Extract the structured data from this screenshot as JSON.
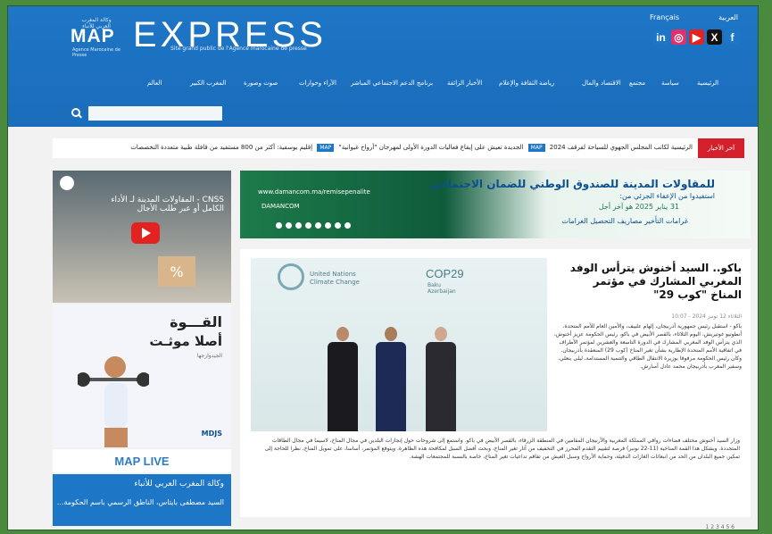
{
  "header": {
    "logo_map": "MAP",
    "logo_crown_text": "وكالة المغرب العربي للأنباء",
    "logo_under": "Agence Marocaine de Presse",
    "logo_express": "EXPRESS",
    "tagline": "Site grand public de l'Agence marocaine de presse",
    "lang_fr": "Français",
    "lang_ar": "العربية",
    "social": [
      {
        "icon": "linkedin-icon",
        "glyph": "in",
        "color": "#1e76c6"
      },
      {
        "icon": "instagram-icon",
        "glyph": "◎",
        "color": "#e1306c"
      },
      {
        "icon": "youtube-icon",
        "glyph": "▶",
        "color": "#e32222"
      },
      {
        "icon": "x-icon",
        "glyph": "X",
        "color": "#111111"
      },
      {
        "icon": "facebook-icon",
        "glyph": "f",
        "color": "#1e76c6"
      }
    ]
  },
  "nav": {
    "items": [
      "الرئيسية",
      "سياسة",
      "مجتمع",
      "الاقتصاد والمال",
      "رياضة",
      "الثقافة والإعلام",
      "الأخبار الزائفة",
      "برنامج الدعم الاجتماعي المباشر",
      "الآراء وحوارات",
      "صوت وصورة",
      "المغرب الكبير",
      "العالم"
    ]
  },
  "search": {
    "placeholder": ""
  },
  "ticker": {
    "label": "آخر الأخبار",
    "item1": "الرئيسية لكاتب المجلس الجهوي للسياحة لفرقف 2024",
    "badge": "MAP",
    "item2": "الجديدة تعيش على إيقاع فعاليات الدورة الأولى لمهرجان \"أرواح غيوانية\"",
    "item3": "إقليم يوسفية: أكثر من 800 مستفيد من قافلة طبية متعددة التخصصات"
  },
  "ad_banner": {
    "title": "للمقاولات المدينة للصندوق الوطني للضمان الاجتماعي",
    "subtitle": "استفيدوا من الإعفاء الجزئي من:",
    "date": "31 يناير 2025 هو آخر أجل",
    "pills": "غرامات التأخير  مصاريف التحصيل  الغرامات",
    "website": "www.damancom.ma/remisepenalite",
    "brand": "DAMANCOM"
  },
  "article": {
    "title": "باكو.. السيد أخنوش يترأس الوفد المغربي المشارك في مؤتمر المناخ \"كوب 29\"",
    "date": "الثلاثاء 12 نونبر 2024 - 10:07",
    "body": "باكو - استقبل رئيس جمهورية أذربيجان، إلهام علييف، والأمين العام للأمم المتحدة، أنطونيو غوتيريش، اليوم الثلاثاء، بالقصر الأبيض في باكو، رئيس الحكومة عزيز أخنوش، الذي يترأس الوفد المغربي المشارك في الدورة التاسعة والعشرين لمؤتمر الأطراف في اتفاقية الأمم المتحدة الإطارية بشأن تغير المناخ (كوب 29) المنعقدة بأذربيجان. وكان رئيس الحكومة مرفوقا بوزيرة الانتقال الطاقي والتنمية المستدامة، ليلى بنعلي، وسفير المغرب بأذربيجان محمد عادل أمبارش.",
    "body_wide": "وزار السيد أخنوش مختلف فضاءات رواقي المملكة المغربية والأرنيجان المقامين في المنطقة الزرقاء، بالقصر الأبيض في باكو. واستمع إلى شروحات حول إنجازات البلدين في مجال المناخ، لاسيما في مجال الطاقات المتجددة. ويشكل هذا القمة المناخية (11-22 نونبر) فرصة لتقييم التقدم المحرز في التخفيف من آثار تغير المناخ، وبحث أفضل السبل لمكافحة هذه الظاهرة. ويتوقع المؤتمر، أساسا، على تمويل المناخ، نظرا للحاجة إلى تمكين جميع البلدان من الحد من انبعاثات الغازات الدفيئة، وحماية الأرواح وسبل العيش من تفاقم تداعيات تغير المناخ، خاصة بالنسبة للمجتمعات الهشة.",
    "image": {
      "un_text": "United Nations\nClimate Change",
      "cop": "COP29",
      "cop_sub": "Baku\nAzerbaijan"
    }
  },
  "sidebar": {
    "video_title": "CNSS - المقاولات المدينة لـ الأداء الكامل أو عبر طلب الأجال",
    "pct": "%",
    "ad2_line1": "القـــوة",
    "ad2_line2": "أصلا موثـت",
    "ad2_line3": "الجيدوارجها",
    "ad2_brand": "MDJS",
    "maplive": "MAP LIVE",
    "agency_title": "وكالة المغرب العربي للأنباء",
    "agency_text": "السيد مصطفى بايتاس، الناطق الرسمي باسم الحكومة..."
  },
  "pager": "1 2 3 4 5 6"
}
